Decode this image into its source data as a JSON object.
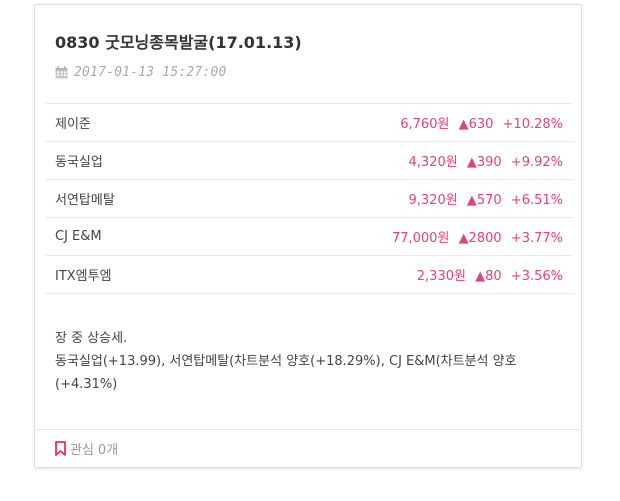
{
  "card": {
    "title": "0830 굿모닝종목발굴(17.01.13)",
    "datetime": "2017-01-13 15:27:00",
    "datetime_icon": "calendar-icon"
  },
  "stocks": [
    {
      "name": "제이준",
      "price": "6,760원",
      "change": "▲630",
      "pct": "+10.28%"
    },
    {
      "name": "동국실업",
      "price": "4,320원",
      "change": "▲390",
      "pct": "+9.92%"
    },
    {
      "name": "서연탑메탈",
      "price": "9,320원",
      "change": "▲570",
      "pct": "+6.51%"
    },
    {
      "name": "CJ E&M",
      "price": "77,000원",
      "change": "▲2800",
      "pct": "+3.77%"
    },
    {
      "name": "ITX엠투엠",
      "price": "2,330원",
      "change": "▲80",
      "pct": "+3.56%"
    }
  ],
  "summary": {
    "line1": "장 중 상승세.",
    "line2": "동국실업(+13.99), 서연탑메탈(차트분석 양호(+18.29%), CJ E&M(차트분석 양호(+4.31%)"
  },
  "footer": {
    "icon": "bookmark-icon",
    "label": "관심",
    "count": "0개"
  },
  "colors": {
    "up": "#e0447c",
    "bookmark": "#e0335e"
  }
}
